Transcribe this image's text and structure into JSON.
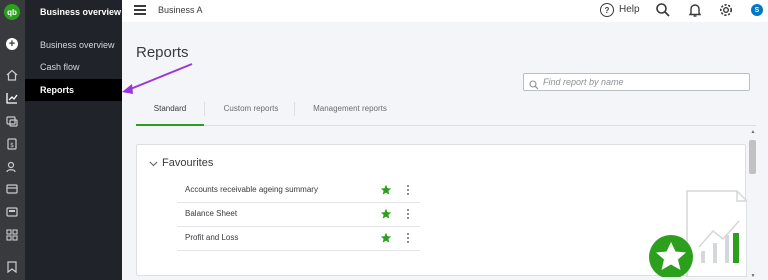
{
  "rail": {
    "logo_text": "qb",
    "icons": [
      "create-icon",
      "home-icon",
      "chart-icon",
      "expenses-icon",
      "sales-icon",
      "customers-icon",
      "cash-icon",
      "projects-icon",
      "apps-icon",
      "bookmark-icon"
    ]
  },
  "nav": {
    "title": "Business overview",
    "items": [
      {
        "label": "Business overview",
        "active": false
      },
      {
        "label": "Cash flow",
        "active": false
      },
      {
        "label": "Reports",
        "active": true
      }
    ]
  },
  "topbar": {
    "company": "Business A",
    "help_label": "Help",
    "avatar_initial": "S"
  },
  "main": {
    "title": "Reports",
    "search": {
      "placeholder": "Find report by name",
      "value": ""
    },
    "tabs": [
      {
        "label": "Standard",
        "active": true
      },
      {
        "label": "Custom reports",
        "active": false
      },
      {
        "label": "Management reports",
        "active": false
      }
    ],
    "favourites": {
      "title": "Favourites",
      "items": [
        {
          "label": "Accounts receivable ageing summary",
          "starred": true
        },
        {
          "label": "Balance Sheet",
          "starred": true
        },
        {
          "label": "Profit and Loss",
          "starred": true
        }
      ]
    }
  },
  "colors": {
    "accent": "#2ca01c",
    "rail": "#393a3d",
    "nav": "#21232a",
    "annotation": "#9b35d9"
  }
}
